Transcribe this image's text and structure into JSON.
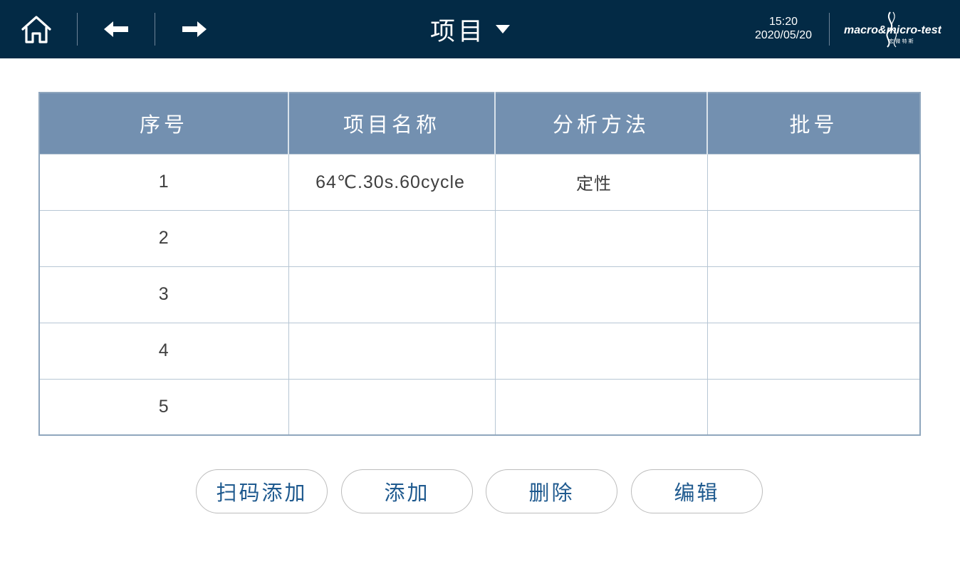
{
  "header": {
    "title": "项目",
    "time": "15:20",
    "date": "2020/05/20",
    "brand_text": "macro&micro-test",
    "brand_sub": "宏 微 特 斯",
    "icons": {
      "home": "home-icon",
      "back": "arrow-left-icon",
      "forward": "arrow-right-icon",
      "dropdown": "caret-down-icon"
    }
  },
  "table": {
    "columns": [
      "序号",
      "项目名称",
      "分析方法",
      "批号"
    ],
    "rows": [
      {
        "index": "1",
        "name": "64℃.30s.60cycle",
        "method": "定性",
        "batch": ""
      },
      {
        "index": "2",
        "name": "",
        "method": "",
        "batch": ""
      },
      {
        "index": "3",
        "name": "",
        "method": "",
        "batch": ""
      },
      {
        "index": "4",
        "name": "",
        "method": "",
        "batch": ""
      },
      {
        "index": "5",
        "name": "",
        "method": "",
        "batch": ""
      }
    ]
  },
  "actions": {
    "scan_add": "扫码添加",
    "add": "添加",
    "delete": "删除",
    "edit": "编辑"
  },
  "colors": {
    "header_bg": "#032a45",
    "table_header_bg": "#7390b0",
    "button_text": "#1f5a8f"
  }
}
